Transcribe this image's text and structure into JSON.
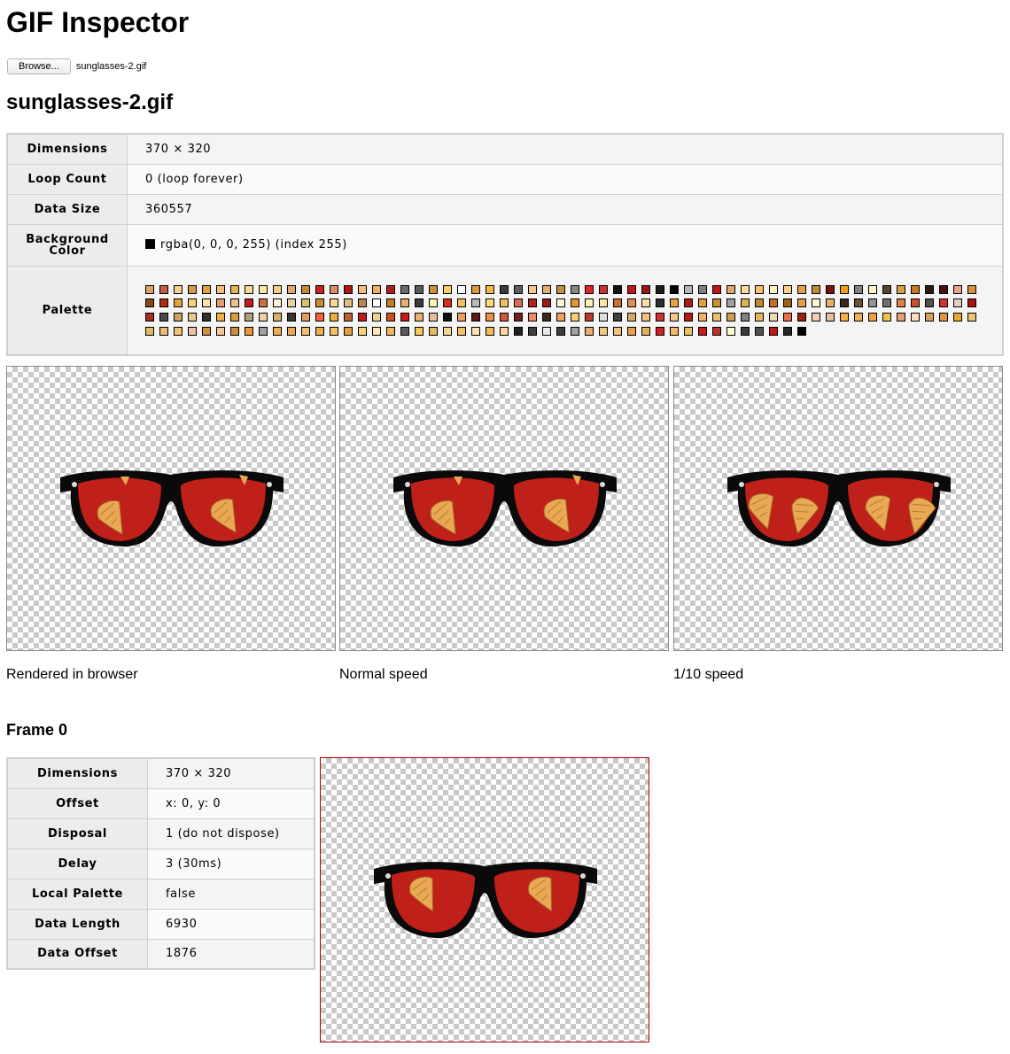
{
  "app": {
    "title": "GIF Inspector"
  },
  "file_picker": {
    "button_label": "Browse...",
    "file_name": "sunglasses-2.gif"
  },
  "file": {
    "title": "sunglasses-2.gif",
    "properties": [
      {
        "label": "Dimensions",
        "value": "370 × 320"
      },
      {
        "label": "Loop Count",
        "value": "0 (loop forever)"
      },
      {
        "label": "Data Size",
        "value": "360557"
      }
    ],
    "background": {
      "label": "Background Color",
      "value": "rgba(0, 0, 0, 255) (index 255)",
      "color": "#000000"
    },
    "palette": {
      "label": "Palette"
    }
  },
  "palette_colors": [
    "#d9a466",
    "#c75a4a",
    "#f6d291",
    "#d49a45",
    "#e3a040",
    "#f2be76",
    "#e6b44e",
    "#f6da96",
    "#fbe7a8",
    "#f6d08a",
    "#e6a86e",
    "#c68a2e",
    "#d21e1e",
    "#da8e6a",
    "#b01616",
    "#f4be7a",
    "#f0b060",
    "#b51d1d",
    "#6c6c6c",
    "#5a5a5a",
    "#c89232",
    "#f8d060",
    "#ffffff",
    "#d99a3a",
    "#f4b848",
    "#3a3a3a",
    "#5e5e5e",
    "#f4c88a",
    "#e0b070",
    "#c09040",
    "#888888",
    "#e02424",
    "#c43434",
    "#111111",
    "#c01818",
    "#9c1616",
    "#1c1c1c",
    "#000000",
    "#b6b6b6",
    "#7e7e7e",
    "#c01414",
    "#dea870",
    "#fcdca0",
    "#f6c070",
    "#fff0c0",
    "#fbd28a",
    "#e6a04a",
    "#c08a3a",
    "#7a1010",
    "#f0a018",
    "#828282",
    "#fff6c8",
    "#5a4628",
    "#d4a040",
    "#c67a1a",
    "#2a1a12",
    "#4a0e0e",
    "#e8a48a",
    "#d8903a",
    "#8a4a12",
    "#b02a1a",
    "#e6a036",
    "#ffd070",
    "#ffe0a8",
    "#e69a6a",
    "#f0c090",
    "#c81c1c",
    "#d07040",
    "#fff0d8",
    "#e8d0a0",
    "#d8c070",
    "#d08a30",
    "#fcd890",
    "#e0c080",
    "#b88a4a",
    "#ffffff",
    "#c08020",
    "#e8b06a",
    "#3c3c3c",
    "#fff4b0",
    "#d43020",
    "#f0c060",
    "#b8b8b8",
    "#ffd878",
    "#f2c060",
    "#dc6a5a",
    "#b22222",
    "#9e1a1a",
    "#fff8d8",
    "#e89830",
    "#ffeebb",
    "#ffe6a0",
    "#d07030",
    "#e09050",
    "#f8e0a8",
    "#2a3030",
    "#e8a040",
    "#b01a1a",
    "#e0a040",
    "#c89030",
    "#a0a0a0",
    "#e0b050",
    "#c08830",
    "#c07020",
    "#a06018",
    "#e0a050",
    "#fff8c8",
    "#e8b060",
    "#3a2a1a",
    "#6a5030",
    "#909090",
    "#707070",
    "#e08040",
    "#c85030",
    "#505050",
    "#d83030",
    "#e0d0c0",
    "#b01010",
    "#a03020",
    "#4a4a4a",
    "#d0a060",
    "#e8c890",
    "#303030",
    "#f0b040",
    "#d8a040",
    "#b0a080",
    "#f0d0a0",
    "#d8b060",
    "#383838",
    "#e0a060",
    "#ff6040",
    "#e8b040",
    "#c06030",
    "#c01c1c",
    "#f0d090",
    "#d05020",
    "#c81818",
    "#e8b070",
    "#e6c0a0",
    "#101010",
    "#e8a060",
    "#5a1a1a",
    "#e8904a",
    "#c85a3a",
    "#702020",
    "#f08a6a",
    "#3a2a20",
    "#f0a060",
    "#f8d070",
    "#c03a2a",
    "#e0e0e0",
    "#404040",
    "#d8a868",
    "#f8c080",
    "#d03030",
    "#f0c880",
    "#b81a1a",
    "#f4b060",
    "#e8c070",
    "#d0a050",
    "#808080",
    "#e8b860",
    "#f0d8b0",
    "#e87048",
    "#a02010",
    "#f0d0b0",
    "#e8c0a0",
    "#f8b040",
    "#f0b050",
    "#f0a048",
    "#f0c050",
    "#e0a070",
    "#f8e0c0",
    "#d8a058",
    "#e89048",
    "#e8a830",
    "#e8c878",
    "#e0b868",
    "#f0b878",
    "#f8c070",
    "#f0c0a0",
    "#d09040",
    "#f8c898",
    "#c89040",
    "#e89838",
    "#a0a0a0",
    "#f0b050",
    "#e8a858",
    "#f0c070",
    "#e8b050",
    "#f8c060",
    "#e0a040",
    "#f8d080",
    "#ffe8b0",
    "#f0b860",
    "#5c5c5c",
    "#f8c858",
    "#e8b860",
    "#f8d890",
    "#f0c068",
    "#fce0b0",
    "#f8b858",
    "#ffd8a0",
    "#202020",
    "#404040",
    "#e8e8e8",
    "#3c3c3c",
    "#a0a0a0",
    "#e8b070",
    "#f0c880",
    "#f8c078",
    "#e8a050",
    "#e0b060",
    "#d02020",
    "#f8b868",
    "#e8c060",
    "#c81818",
    "#c03030",
    "#fffbd0",
    "#3a3a3a",
    "#505050",
    "#c01818",
    "#282828",
    "#000000"
  ],
  "previews": [
    {
      "caption": "Rendered in browser"
    },
    {
      "caption": "Normal speed"
    },
    {
      "caption": "1/10 speed"
    }
  ],
  "frame": {
    "title": "Frame 0",
    "properties": [
      {
        "label": "Dimensions",
        "value": "370 × 320"
      },
      {
        "label": "Offset",
        "value": "x: 0, y: 0"
      },
      {
        "label": "Disposal",
        "value": "1 (do not dispose)"
      },
      {
        "label": "Delay",
        "value": "3 (30ms)"
      },
      {
        "label": "Local Palette",
        "value": "false"
      },
      {
        "label": "Data Length",
        "value": "6930"
      },
      {
        "label": "Data Offset",
        "value": "1876"
      }
    ]
  },
  "colors": {
    "lens": "#c0201a",
    "frame": "#0a0a0a",
    "cone": "#e9a954",
    "frame_preview_border": "#b00000"
  }
}
